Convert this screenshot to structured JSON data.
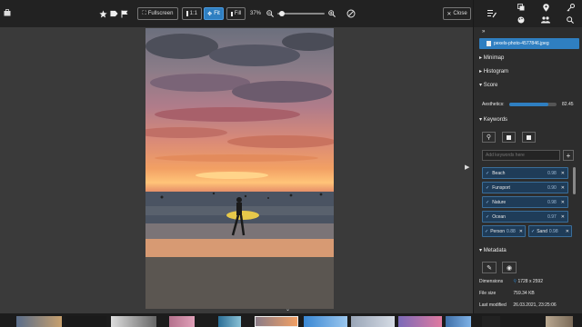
{
  "toolbar": {
    "fullscreen_label": "Fullscreen",
    "one_to_one_label": "1:1",
    "fit_label": "Fit",
    "fill_label": "Fill",
    "zoom_percent": "37%",
    "zoom_slider_fraction": 0.05,
    "close_label": "Close"
  },
  "sidebar": {
    "file_name": "pexels-photo-4577846.jpeg",
    "sections": {
      "minimap": "Minimap",
      "histogram": "Histogram",
      "score": "Score",
      "keywords": "Keywords",
      "metadata": "Metadata"
    },
    "score": {
      "label": "Aesthetics:",
      "value": "82.45",
      "fraction": 0.82
    },
    "keyword_input_placeholder": "Add keywords here",
    "keywords": [
      {
        "name": "Beach",
        "score": "0.98"
      },
      {
        "name": "Funsport",
        "score": "0.90"
      },
      {
        "name": "Nature",
        "score": "0.98"
      },
      {
        "name": "Ocean",
        "score": "0.97"
      }
    ],
    "keywords_pair": [
      {
        "name": "Person",
        "score": "0.88"
      },
      {
        "name": "Sand",
        "score": "0.98"
      }
    ],
    "metadata": [
      {
        "label": "Dimensions",
        "value": "1728 x 2592"
      },
      {
        "label": "File size",
        "value": "759.34 KB"
      },
      {
        "label": "Last modified",
        "value": "26.03.2021, 23:25:06"
      }
    ]
  },
  "colors": {
    "accent": "#2f7fc1",
    "keyword_bg": "#1f3c58"
  }
}
